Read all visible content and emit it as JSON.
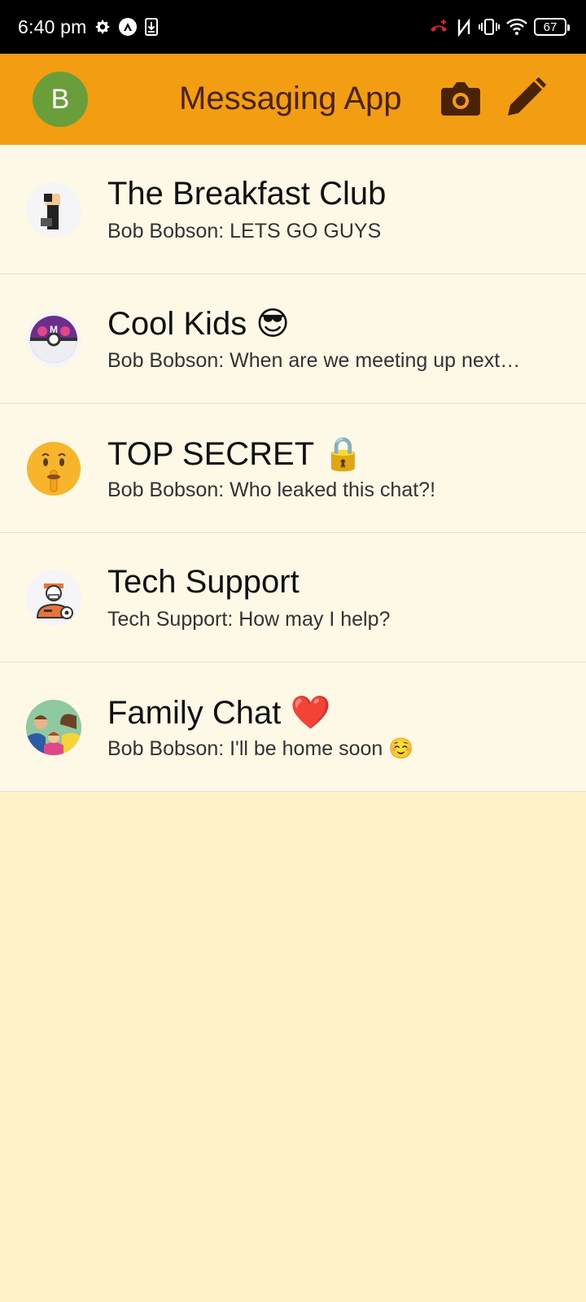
{
  "status_bar": {
    "time": "6:40 pm",
    "battery": "67"
  },
  "app_bar": {
    "avatar_letter": "B",
    "title": "Messaging App",
    "icons": [
      "camera-icon",
      "pencil-icon"
    ]
  },
  "chats": [
    {
      "name": "The Breakfast Club",
      "preview": "Bob Bobson: LETS GO GUYS",
      "avatar_icon": "fist-icon"
    },
    {
      "name": "Cool Kids 😎",
      "preview": "Bob Bobson: When are we meeting up next…",
      "avatar_icon": "master-ball-icon"
    },
    {
      "name": "TOP SECRET 🔒",
      "preview": "Bob Bobson: Who leaked this chat?!",
      "avatar_icon": "shushing-face-icon"
    },
    {
      "name": "Tech Support",
      "preview": "Tech Support: How may I help?",
      "avatar_icon": "support-agent-icon"
    },
    {
      "name": "Family Chat ❤️",
      "preview": "Bob Bobson: I'll be home soon ☺️",
      "avatar_icon": "family-icon"
    }
  ],
  "colors": {
    "app_bar": "#F29D12",
    "title_text": "#4A2305",
    "avatar_bg": "#6A9E3A",
    "list_bg": "#FEF9E7",
    "page_bg": "#FDF2C8"
  }
}
